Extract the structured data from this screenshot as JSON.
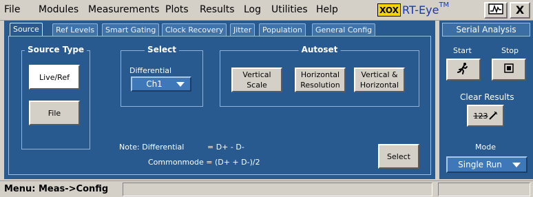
{
  "menubar": {
    "items": [
      "File",
      "Modules",
      "Measurements",
      "Plots",
      "Results",
      "Log",
      "Utilities",
      "Help"
    ],
    "app_title": "RT-Eye",
    "trademark": "TM",
    "close_label": "X"
  },
  "tabs": [
    "Source",
    "Ref Levels",
    "Smart Gating",
    "Clock Recovery",
    "Jitter",
    "Population",
    "General Config"
  ],
  "source_type": {
    "title": "Source Type",
    "live_ref_label": "Live/Ref",
    "file_label": "File"
  },
  "select_group": {
    "title": "Select",
    "differential_label": "Differential",
    "channel_value": "Ch1"
  },
  "autoset": {
    "title": "Autoset",
    "vertical_scale_label": "Vertical Scale",
    "horizontal_resolution_label": "Horizontal Resolution",
    "vertical_horizontal_label": "Vertical & Horizontal"
  },
  "note": {
    "line1_prefix": "Note: Differential",
    "line1_formula": "= D+ - D-",
    "line2": "Commonmode = (D+ + D-)/2"
  },
  "select_button_label": "Select",
  "serial_analysis": {
    "title": "Serial Analysis",
    "start_label": "Start",
    "stop_label": "Stop",
    "clear_results_label": "Clear Results",
    "clear_icon_text": "123",
    "mode_label": "Mode",
    "mode_value": "Single Run"
  },
  "status": {
    "menu_path": "Menu: Meas->Config"
  },
  "colors": {
    "panel": "#285a8f",
    "chrome": "#d4d0c8",
    "logo_yellow": "#f3d400",
    "title_blue": "#1a36a8"
  }
}
